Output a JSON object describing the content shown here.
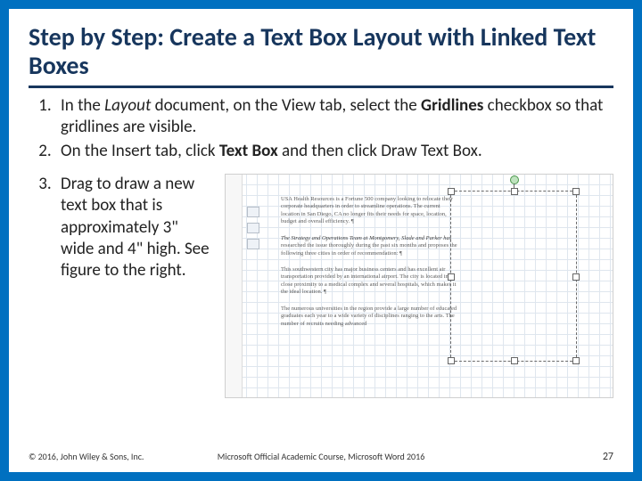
{
  "title": "Step by Step: Create a Text Box Layout with Linked Text Boxes",
  "steps": {
    "s1_pre": "In the ",
    "s1_layout": "Layout",
    "s1_mid": " document, on the View tab, select the ",
    "s1_gridlines": "Gridlines",
    "s1_post": " checkbox so that gridlines are visible.",
    "s2_pre": "On the Insert tab, click ",
    "s2_textbox": "Text Box",
    "s2_post": " and then click Draw Text Box.",
    "s3": "Drag to draw a new text box that is approximately 3\" wide and 4\" high. See figure to the right."
  },
  "figure": {
    "p1": "USA Health Resources is a Fortune 500 company looking to relocate their corporate headquarters in order to streamline operations. The current location in San Diego, CA no longer fits their needs for space, location, budget and overall efficiency. ¶",
    "p2_head": "The Strategy and Operations Team at Montgomery, Slade and Parker has",
    "p2_rest": " researched the issue thoroughly during the past six months and proposes the following three cities in order of recommendation: ¶",
    "p3": "This southwestern city has major business centers and has excellent air transportation provided by an international airport. The city is located in close proximity to a medical complex and several hospitals, which makes it the ideal location. ¶",
    "p4": "The numerous universities in the region provide a large number of educated graduates each year to a wide variety of disciplines ranging to the arts. The number of recruits needing advanced"
  },
  "footer": {
    "copyright": "© 2016, John Wiley & Sons, Inc.",
    "course": "Microsoft Official Academic Course, Microsoft Word 2016",
    "page": "27"
  }
}
